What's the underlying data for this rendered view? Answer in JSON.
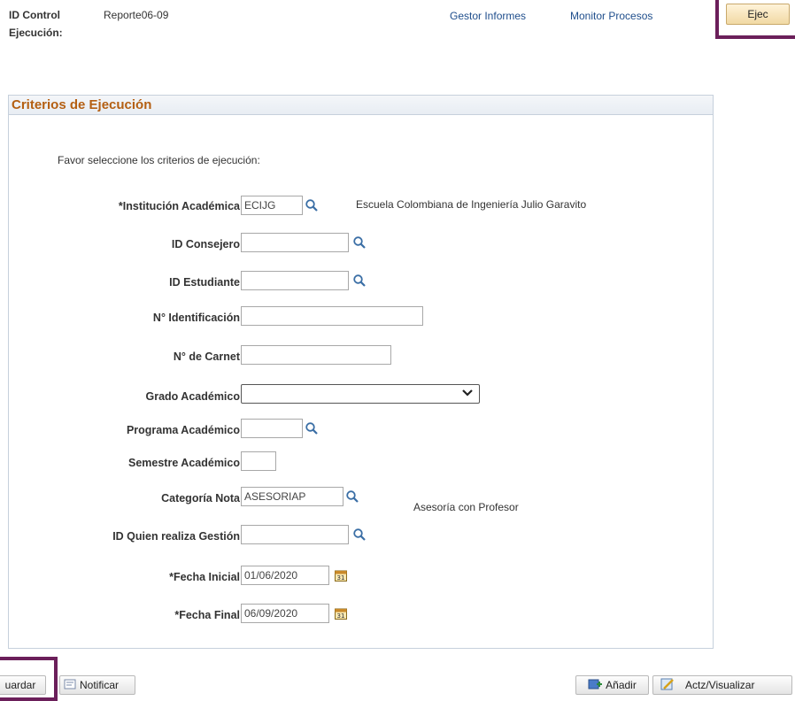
{
  "header": {
    "run_control_label_1": "ID Control",
    "run_control_label_2": "Ejecución:",
    "run_control_value": "Reporte06-09",
    "links": {
      "report_manager": "Gestor Informes",
      "process_monitor": "Monitor Procesos"
    },
    "run_button": "Ejec"
  },
  "section": {
    "title": "Criterios de Ejecución",
    "instruction": "Favor seleccione los criterios de ejecución:"
  },
  "fields": {
    "institution": {
      "label": "*Institución Académica",
      "value": "ECIJG",
      "description": "Escuela Colombiana de Ingeniería Julio Garavito"
    },
    "advisor_id": {
      "label": "ID Consejero",
      "value": ""
    },
    "student_id": {
      "label": "ID Estudiante",
      "value": ""
    },
    "identification": {
      "label": "N° Identificación",
      "value": ""
    },
    "card_number": {
      "label": "N° de Carnet",
      "value": ""
    },
    "academic_career": {
      "label": "Grado Académico",
      "value": ""
    },
    "academic_program": {
      "label": "Programa Académico",
      "value": ""
    },
    "term": {
      "label": "Semestre Académico",
      "value": ""
    },
    "note_category": {
      "label": "Categoría Nota",
      "value": "ASESORIAP",
      "description": "Asesoría con Profesor"
    },
    "operator_id": {
      "label": "ID Quien realiza Gestión",
      "value": ""
    },
    "start_date": {
      "label": "*Fecha Inicial",
      "value": "01/06/2020"
    },
    "end_date": {
      "label": "*Fecha Final",
      "value": "06/09/2020"
    }
  },
  "footer": {
    "save": "uardar",
    "notify": "Notificar",
    "add": "Añadir",
    "update_display": "Actz/Visualizar"
  },
  "colors": {
    "highlight": "#6b1f5a",
    "section_title": "#b45f12",
    "link": "#1f4e8c"
  }
}
